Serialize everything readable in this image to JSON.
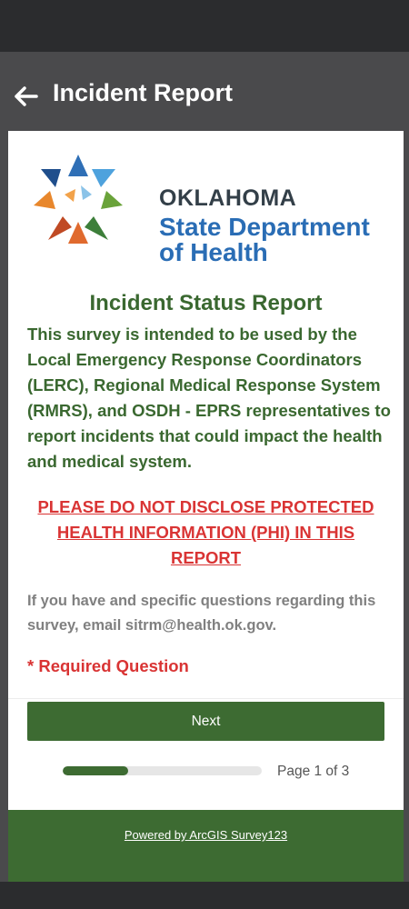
{
  "appbar": {
    "title": "Incident Report",
    "back_icon": "arrow-left-icon"
  },
  "logo": {
    "line1": "OKLAHOMA",
    "line2": "State Department",
    "line3": "of Health",
    "colors": {
      "navy": "#333f48",
      "blue": "#2a6db5"
    }
  },
  "survey": {
    "title": "Incident Status Report",
    "intro": "This survey is intended to be used by the Local Emergency Response Coordinators (LERC), Regional Medical Response System (RMRS), and OSDH - EPRS representatives to report incidents that could impact the health and medical system.",
    "warning": "PLEASE DO NOT DISCLOSE PROTECTED HEALTH INFORMATION (PHI) IN THIS REPORT",
    "contact": "If you have and specific questions regarding this survey, email sitrm@health.ok.gov.",
    "required_note": "* Required Question"
  },
  "navigation": {
    "next_label": "Next",
    "page_indicator": "Page 1 of 3",
    "progress_fraction": 0.33
  },
  "footer": {
    "powered_by": "Powered by ArcGIS Survey123"
  },
  "colors": {
    "accent_green": "#3d6b32",
    "warning_red": "#d93434"
  }
}
